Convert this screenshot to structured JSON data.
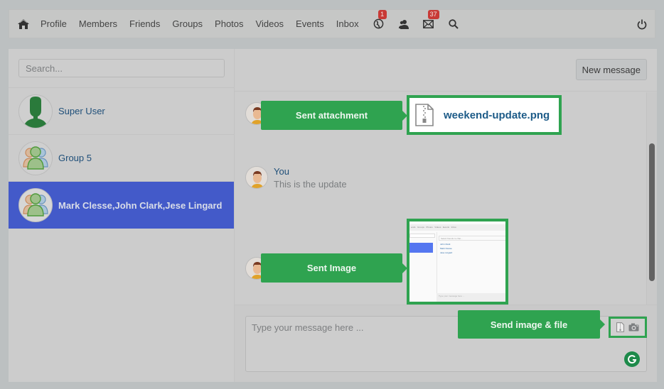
{
  "nav": {
    "home_icon": "home-icon",
    "links": [
      "Profile",
      "Members",
      "Friends",
      "Groups",
      "Photos",
      "Videos",
      "Events",
      "Inbox"
    ],
    "icons": [
      {
        "name": "globe-icon",
        "badge": "1"
      },
      {
        "name": "friends-icon",
        "badge": null
      },
      {
        "name": "envelope-icon",
        "badge": "37"
      },
      {
        "name": "search-icon",
        "badge": null
      }
    ],
    "power_icon": "power-icon"
  },
  "sidebar": {
    "search_placeholder": "Search...",
    "contacts": [
      {
        "name": "Super User",
        "avatar": "user-silhouette",
        "active": false
      },
      {
        "name": "Group 5",
        "avatar": "group",
        "active": false
      },
      {
        "name": "Mark Clesse,John Clark,Jese Lingard",
        "avatar": "group",
        "active": true
      }
    ]
  },
  "chat": {
    "new_message_label": "New message",
    "messages": [
      {
        "type": "attachment",
        "file_name": "weekend-update.png",
        "callout": "Sent attachment"
      },
      {
        "type": "text",
        "sender": "You",
        "text": "This is the update"
      },
      {
        "type": "image",
        "callout": "Sent Image",
        "thumbnail": {
          "nav_items": [
            "ends",
            "Groups",
            "Photos",
            "Videos",
            "Events",
            "Inbox"
          ],
          "search_placeholder": "Select friends to chat...",
          "friends": [
            "John Clark",
            "Mark Clesse",
            "Jese Lingard"
          ],
          "input_placeholder": "Type your message here ..."
        }
      }
    ],
    "composer": {
      "placeholder": "Type your message here ...",
      "callout": "Send image & file",
      "icons": [
        "file-zip-icon",
        "camera-icon"
      ]
    }
  },
  "colors": {
    "accent_green": "#2fa350",
    "active_contact": "#435ac9",
    "badge_red": "#c83a36",
    "link_blue": "#1f4f79"
  }
}
